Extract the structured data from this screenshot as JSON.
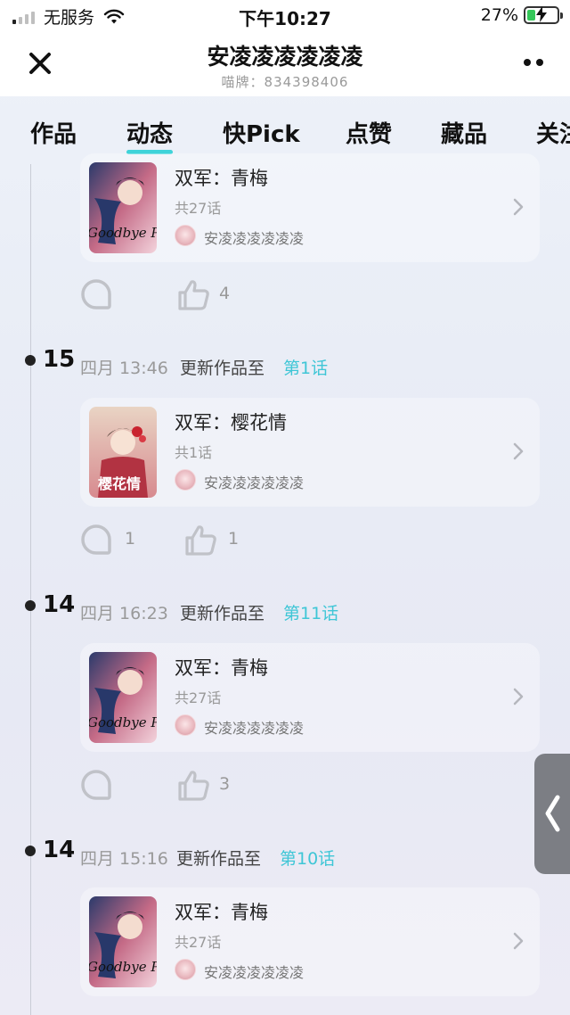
{
  "status_bar": {
    "carrier": "无服务",
    "time": "下午10:27",
    "battery_percent": "27%",
    "battery_level": 0.27,
    "icons": [
      "signal-icon",
      "wifi-icon",
      "battery-icon",
      "charging-bolt-icon"
    ]
  },
  "header": {
    "title": "安凌凌凌凌凌凌",
    "subtitle": "喵牌：834398406",
    "close_icon": "close-icon",
    "more_icon": "more-dots-icon"
  },
  "tabs": [
    {
      "label": "作品",
      "active": false
    },
    {
      "label": "动态",
      "active": true
    },
    {
      "label": "快Pick",
      "active": false
    },
    {
      "label": "点赞",
      "active": false
    },
    {
      "label": "藏品",
      "active": false
    },
    {
      "label": "关注",
      "active": false
    }
  ],
  "accent_color": "#3fd3d9",
  "feed": [
    {
      "day": "",
      "time": "",
      "action": "",
      "episode": "",
      "card": {
        "title": "双军：青梅",
        "episodes": "共27话",
        "author": "安凌凌凌凌凌凌",
        "cover_text": "Goodbye Patriot"
      },
      "comments": "",
      "likes": "4"
    },
    {
      "day": "15",
      "time": "四月 13:46",
      "action": "更新作品至",
      "episode": "第1话",
      "card": {
        "title": "双军：樱花情",
        "episodes": "共1话",
        "author": "安凌凌凌凌凌凌",
        "cover_text": "樱花情"
      },
      "comments": "1",
      "likes": "1"
    },
    {
      "day": "14",
      "time": "四月 16:23",
      "action": "更新作品至",
      "episode": "第11话",
      "card": {
        "title": "双军：青梅",
        "episodes": "共27话",
        "author": "安凌凌凌凌凌凌",
        "cover_text": "Goodbye Patriot"
      },
      "comments": "",
      "likes": "3"
    },
    {
      "day": "14",
      "time": "四月 15:16",
      "action": "更新作品至",
      "episode": "第10话",
      "card": {
        "title": "双军：青梅",
        "episodes": "共27话",
        "author": "安凌凌凌凌凌凌",
        "cover_text": "Goodbye Patriot"
      },
      "comments": "",
      "likes": ""
    }
  ]
}
